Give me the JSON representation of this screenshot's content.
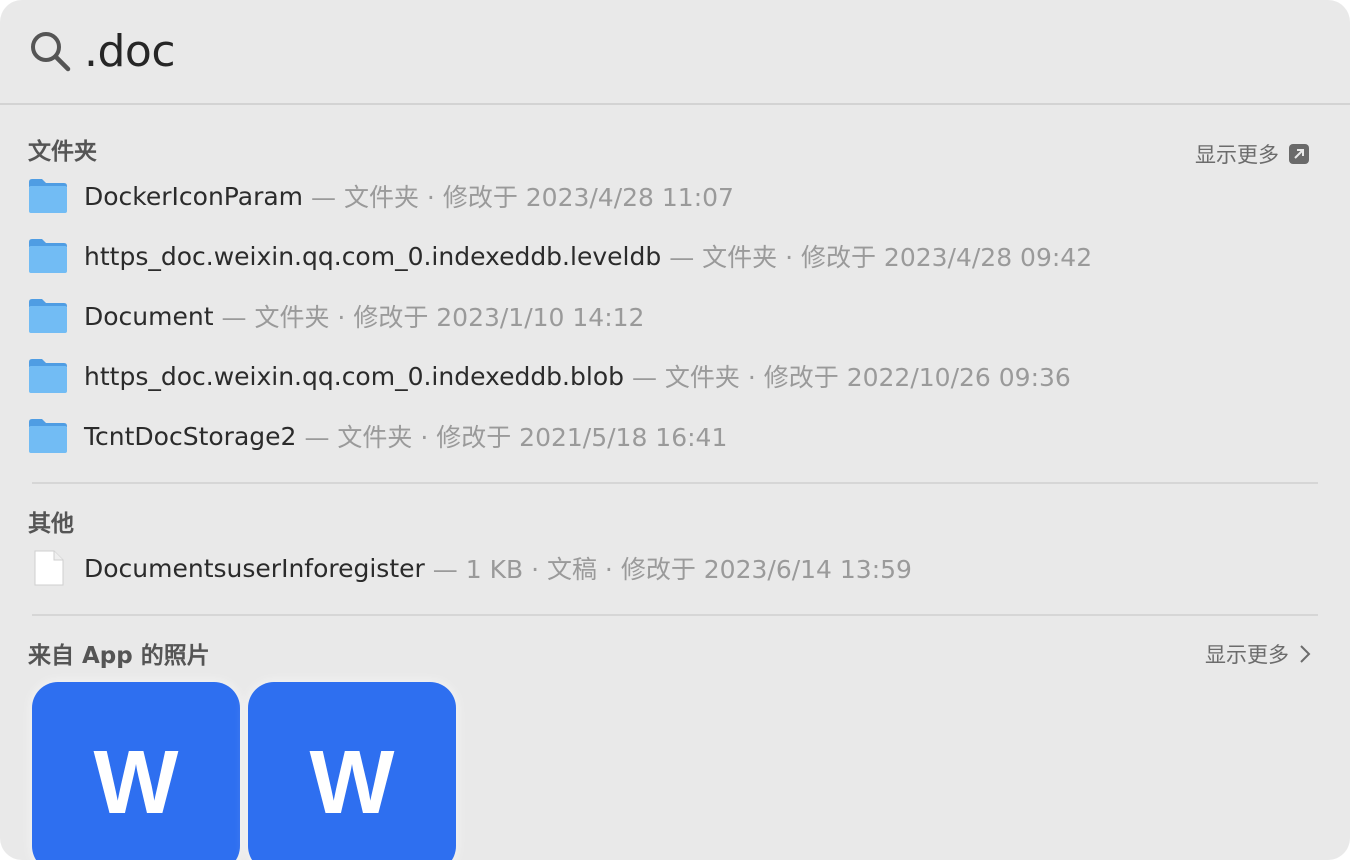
{
  "search": {
    "query": ".doc"
  },
  "sections": {
    "folders": {
      "title": "文件夹",
      "show_more": "显示更多",
      "items": [
        {
          "name": "DockerIconParam",
          "meta": "— 文件夹 · 修改于 2023/4/28 11:07"
        },
        {
          "name": "https_doc.weixin.qq.com_0.indexeddb.leveldb",
          "meta": "— 文件夹 · 修改于 2023/4/28 09:42"
        },
        {
          "name": "Document",
          "meta": "— 文件夹 · 修改于 2023/1/10 14:12"
        },
        {
          "name": "https_doc.weixin.qq.com_0.indexeddb.blob",
          "meta": "— 文件夹 · 修改于 2022/10/26 09:36"
        },
        {
          "name": "TcntDocStorage2",
          "meta": "— 文件夹 · 修改于 2021/5/18 16:41"
        }
      ]
    },
    "other": {
      "title": "其他",
      "items": [
        {
          "name": "DocumentsuserInforegister",
          "meta": "— 1 KB · 文稿 · 修改于 2023/6/14 13:59"
        }
      ]
    },
    "photos": {
      "title": "来自 App 的照片",
      "show_more": "显示更多",
      "thumbs": [
        {
          "letter": "W"
        },
        {
          "letter": "W"
        }
      ]
    }
  },
  "colors": {
    "background": "#e9e9e9",
    "folder_blue": "#6bb6f2",
    "app_blue": "#2e6ff0"
  }
}
